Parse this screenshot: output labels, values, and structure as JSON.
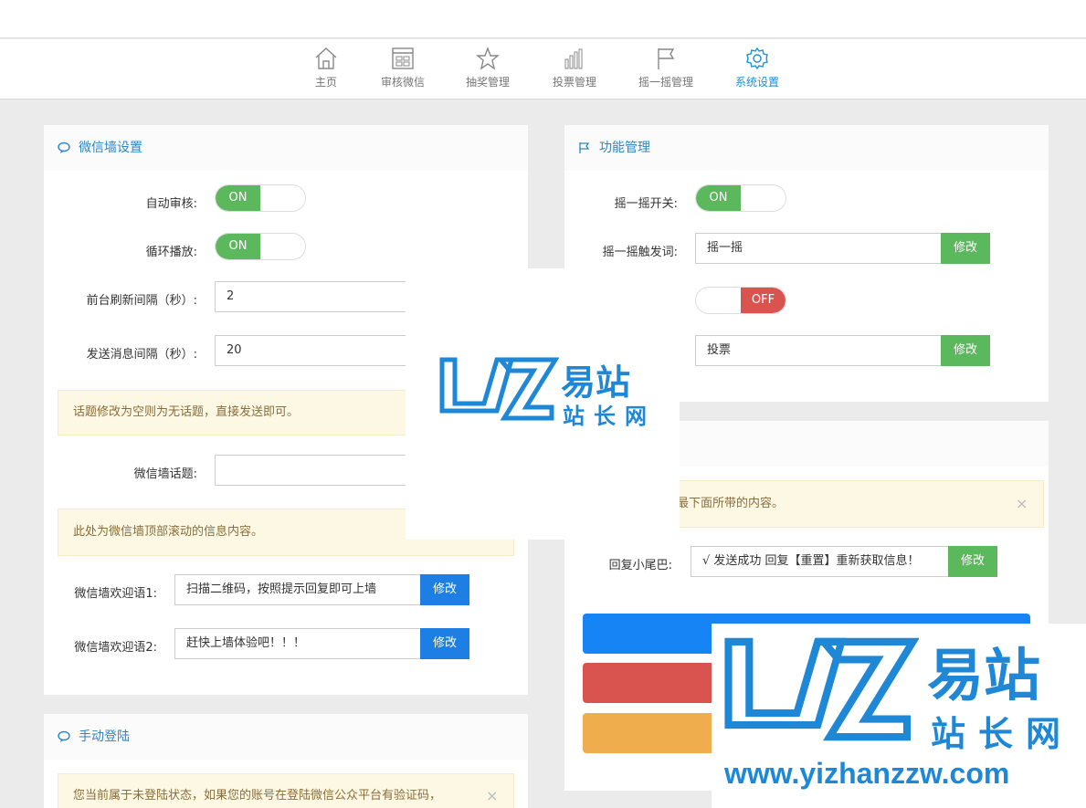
{
  "nav": {
    "items": [
      {
        "label": "主页",
        "icon": "home-icon"
      },
      {
        "label": "审核微信",
        "icon": "review-icon"
      },
      {
        "label": "抽奖管理",
        "icon": "star-icon"
      },
      {
        "label": "投票管理",
        "icon": "bar-chart-icon"
      },
      {
        "label": "摇一摇管理",
        "icon": "flag-icon"
      },
      {
        "label": "系统设置",
        "icon": "gear-icon"
      }
    ],
    "active_color": "#1a8fd8"
  },
  "wall": {
    "title": "微信墙设置",
    "auto_review_label": "自动审核:",
    "auto_review_state": "ON",
    "loop_label": "循环播放:",
    "loop_state": "ON",
    "refresh_label": "前台刷新间隔（秒）:",
    "refresh_value": "2",
    "send_label": "发送消息间隔（秒）:",
    "send_value": "20",
    "topic_alert": "话题修改为空则为无话题，直接发送即可。",
    "topic_label": "微信墙话题:",
    "topic_value": "",
    "scroll_alert": "此处为微信墙顶部滚动的信息内容。",
    "welcome1_label": "微信墙欢迎语1:",
    "welcome1_value": "扫描二维码，按照提示回复即可上墙",
    "welcome2_label": "微信墙欢迎语2:",
    "welcome2_value": "赶快上墙体验吧！！！",
    "modify": "修改"
  },
  "func": {
    "title": "功能管理",
    "shake_switch_label": "摇一摇开关:",
    "shake_switch_state": "ON",
    "shake_word_label": "摇一摇触发词:",
    "shake_word_value": "摇一摇",
    "vote_switch_state": "OFF",
    "vote_word_value": "投票",
    "modify": "修改"
  },
  "reply": {
    "alert": "在微信的回复中最下面所带的内容。",
    "close": "×",
    "tail_label": "回复小尾巴:",
    "tail_value": "√ 发送成功  回复【重置】重新获取信息！",
    "modify": "修改"
  },
  "login": {
    "title": "手动登陆",
    "alert": "您当前属于未登陆状态，如果您的账号在登陆微信公众平台有验证码，",
    "close": "×"
  },
  "watermark": {
    "brand_cn": "易站",
    "sub_cn": "站长网",
    "url": "www.yizhanzzw.com",
    "brand_color": "#1e88d7"
  },
  "colors": {
    "green": "#5cb85c",
    "red": "#d9534f",
    "blue": "#1d7fe3",
    "orange": "#f0ad4e",
    "bigblue": "#1784f5"
  }
}
